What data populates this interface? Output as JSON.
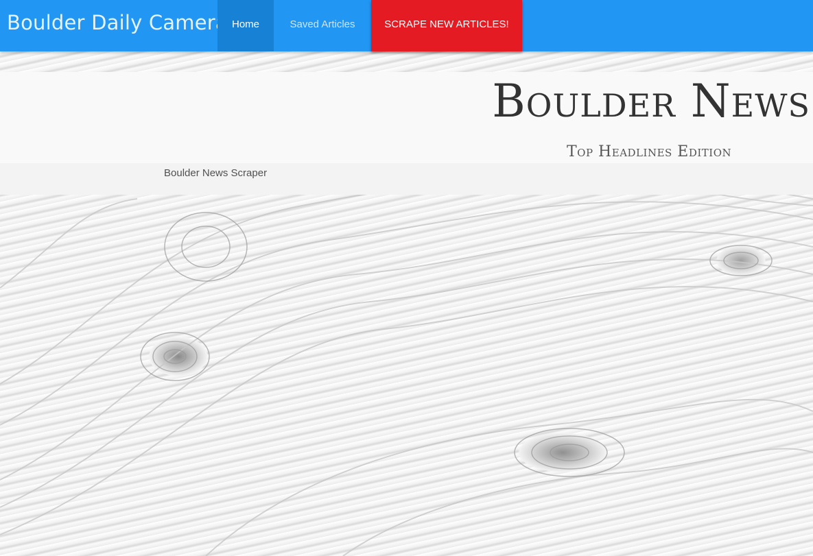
{
  "navbar": {
    "brand": "Boulder Daily Camera",
    "items": [
      {
        "label": "Home"
      },
      {
        "label": "Saved Articles"
      },
      {
        "label": "SCRAPE NEW ARTICLES!"
      }
    ],
    "colors": {
      "bar": "#2196f3",
      "active": "#1781d6",
      "scrape": "#e41b23"
    }
  },
  "header": {
    "title": "Boulder News",
    "subtitle": "Top Headlines Edition"
  },
  "info": {
    "text": "Boulder News Scraper"
  },
  "background": {
    "image": "rolled-newspaper-paper-texture"
  }
}
